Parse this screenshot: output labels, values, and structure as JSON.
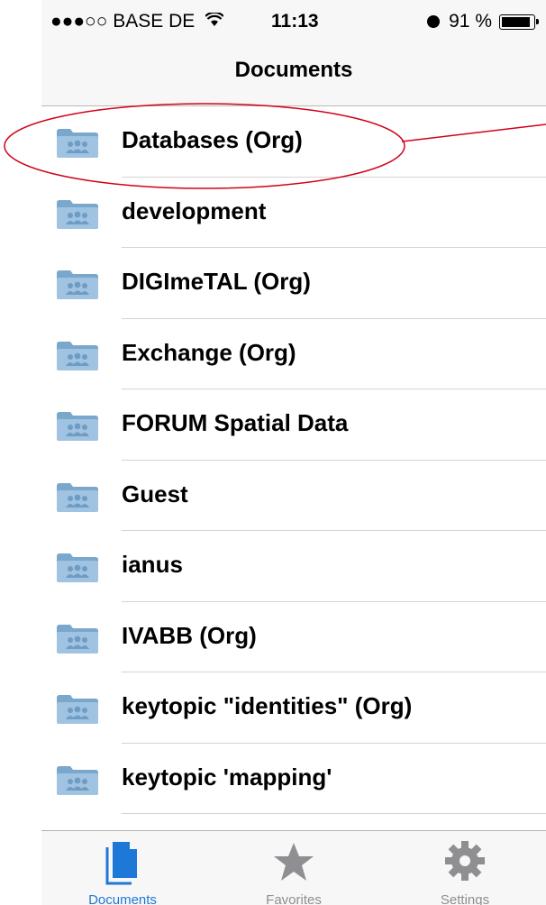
{
  "status_bar": {
    "carrier": "●●●○○ BASE DE",
    "wifi_icon": "wifi-icon",
    "time": "11:13",
    "battery": "91 %"
  },
  "nav": {
    "title": "Documents"
  },
  "folders": [
    {
      "label": "Databases (Org)"
    },
    {
      "label": "development"
    },
    {
      "label": "DIGImeTAL (Org)"
    },
    {
      "label": "Exchange (Org)"
    },
    {
      "label": "FORUM Spatial Data"
    },
    {
      "label": "Guest"
    },
    {
      "label": "ianus"
    },
    {
      "label": "IVABB (Org)"
    },
    {
      "label": "keytopic \"identities\" (Org)"
    },
    {
      "label": "keytopic 'mapping'"
    }
  ],
  "tabs": [
    {
      "label": "Documents",
      "icon": "documents-icon",
      "active": true
    },
    {
      "label": "Favorites",
      "icon": "star-icon",
      "active": false
    },
    {
      "label": "Settings",
      "icon": "gear-icon",
      "active": false
    }
  ],
  "colors": {
    "accent": "#1d78d8",
    "annotation": "#d0021b",
    "folder": "#8fb6d6"
  }
}
